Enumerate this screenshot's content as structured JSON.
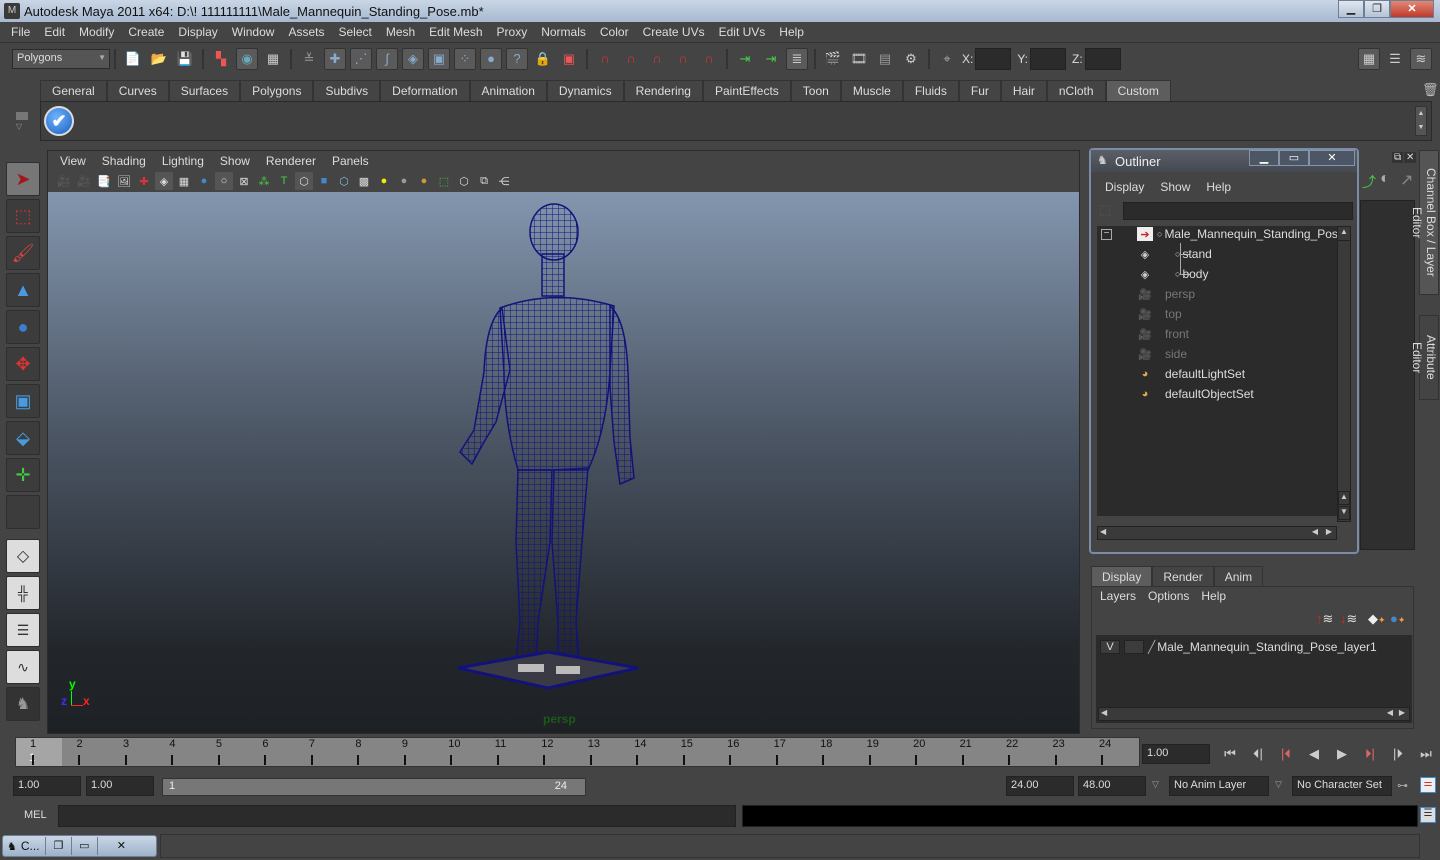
{
  "window": {
    "title": "Autodesk Maya 2011 x64: D:\\! 111111111\\Male_Mannequin_Standing_Pose.mb*",
    "minimize": "▁",
    "restore": "❐",
    "close": "✕"
  },
  "menubar": [
    "File",
    "Edit",
    "Modify",
    "Create",
    "Display",
    "Window",
    "Assets",
    "Select",
    "Mesh",
    "Edit Mesh",
    "Proxy",
    "Normals",
    "Color",
    "Create UVs",
    "Edit UVs",
    "Help"
  ],
  "statusline": {
    "menuset": "Polygons",
    "x_label": "X:",
    "y_label": "Y:",
    "z_label": "Z:",
    "x_value": "",
    "y_value": "",
    "z_value": ""
  },
  "shelf": {
    "tabs": [
      "General",
      "Curves",
      "Surfaces",
      "Polygons",
      "Subdivs",
      "Deformation",
      "Animation",
      "Dynamics",
      "Rendering",
      "PaintEffects",
      "Toon",
      "Muscle",
      "Fluids",
      "Fur",
      "Hair",
      "nCloth",
      "Custom"
    ],
    "active_tab": "Custom"
  },
  "viewport": {
    "menu": [
      "View",
      "Shading",
      "Lighting",
      "Show",
      "Renderer",
      "Panels"
    ],
    "camera_label": "persp",
    "axis": {
      "y": "y",
      "z": "z",
      "x": "x"
    },
    "wire_color": "#12127a"
  },
  "outliner": {
    "title": "Outliner",
    "menu": [
      "Display",
      "Show",
      "Help"
    ],
    "filter_value": "",
    "items": [
      {
        "label": "Male_Mannequin_Standing_Pose",
        "icon": "transform-icon",
        "dim": false,
        "indent": 0
      },
      {
        "label": "stand",
        "icon": "mesh-icon",
        "dim": false,
        "indent": 1
      },
      {
        "label": "body",
        "icon": "mesh-icon",
        "dim": false,
        "indent": 1
      },
      {
        "label": "persp",
        "icon": "camera-icon",
        "dim": true,
        "indent": 0
      },
      {
        "label": "top",
        "icon": "camera-icon",
        "dim": true,
        "indent": 0
      },
      {
        "label": "front",
        "icon": "camera-icon",
        "dim": true,
        "indent": 0
      },
      {
        "label": "side",
        "icon": "camera-icon",
        "dim": true,
        "indent": 0
      },
      {
        "label": "defaultLightSet",
        "icon": "set-icon",
        "dim": false,
        "indent": 0
      },
      {
        "label": "defaultObjectSet",
        "icon": "set-icon",
        "dim": false,
        "indent": 0
      }
    ]
  },
  "side_tabs": {
    "channel_box": "Channel Box / Layer Editor",
    "attribute_editor": "Attribute Editor"
  },
  "layer_editor": {
    "tabs": [
      "Display",
      "Render",
      "Anim"
    ],
    "active_tab": "Display",
    "menu": [
      "Layers",
      "Options",
      "Help"
    ],
    "layers": [
      {
        "visible": "V",
        "name": "Male_Mannequin_Standing_Pose_layer1"
      }
    ]
  },
  "timeline": {
    "frames": [
      1,
      2,
      3,
      4,
      5,
      6,
      7,
      8,
      9,
      10,
      11,
      12,
      13,
      14,
      15,
      16,
      17,
      18,
      19,
      20,
      21,
      22,
      23,
      24
    ],
    "current_frame_marker": "1",
    "current_frame": "1.00"
  },
  "range": {
    "start_time": "1.00",
    "playback_start": "1.00",
    "range_start_label": "1",
    "range_end_label": "24",
    "playback_end": "24.00",
    "end_time": "48.00",
    "anim_layer": "No Anim Layer",
    "character_set": "No Character Set"
  },
  "command": {
    "label": "MEL",
    "input_value": "",
    "output_value": ""
  },
  "minimized_window": {
    "label": "C...",
    "restore": "❐",
    "maximize": "▭",
    "close": "✕"
  },
  "playback_buttons": [
    "⏮",
    "⏴|",
    "|⏴",
    "◀",
    "▶",
    "⏵|",
    "|⏵",
    "⏭"
  ]
}
